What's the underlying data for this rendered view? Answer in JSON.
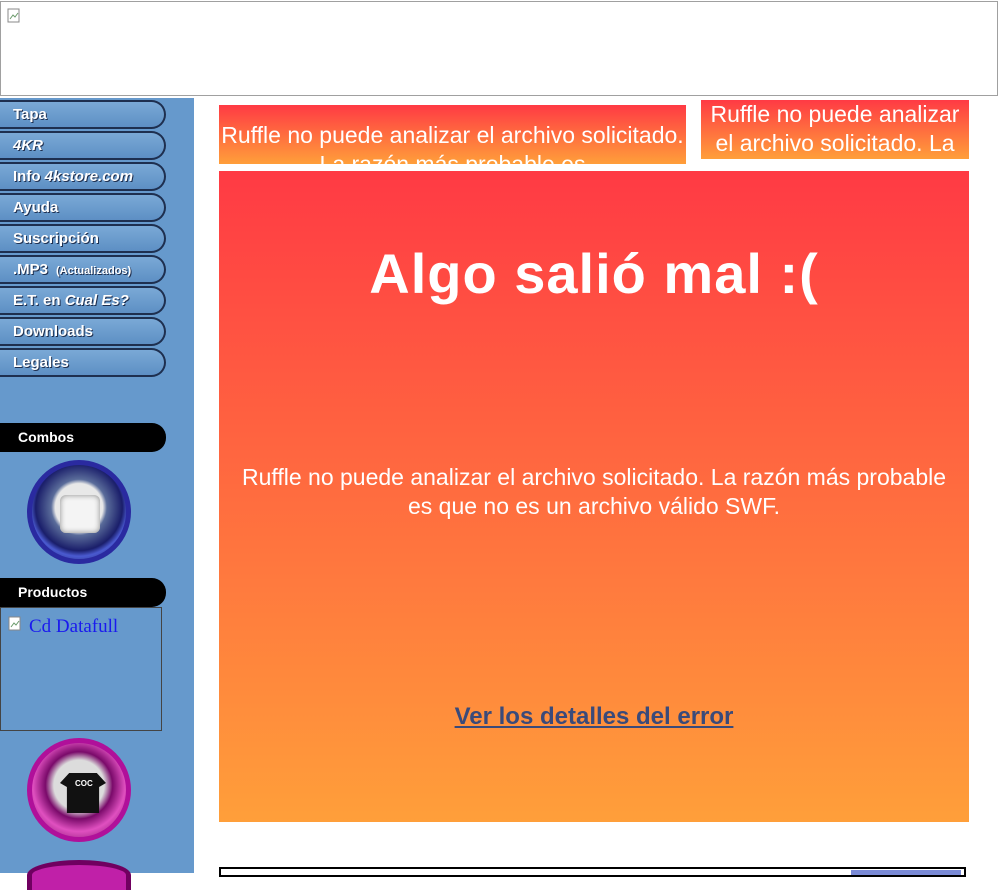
{
  "nav": {
    "items": [
      {
        "label": "Tapa"
      },
      {
        "label": "4KR"
      },
      {
        "label": "Info",
        "extra": "4kstore.com"
      },
      {
        "label": "Ayuda"
      },
      {
        "label": "Suscripción"
      },
      {
        "label": ".MP3",
        "extra": "(Actualizados)"
      },
      {
        "label": "E.T. en",
        "extra": "Cual Es?"
      },
      {
        "label": "Downloads"
      },
      {
        "label": "Legales"
      }
    ]
  },
  "sections": {
    "combos": "Combos",
    "productos": "Productos",
    "product_link": "Cd Datafull",
    "shirt_logo": "COC"
  },
  "ruffle": {
    "small_1": "Ruffle no puede analizar el archivo solicitado. La razón más probable es",
    "small_2": "Ruffle no puede analizar el archivo solicitado. La razón",
    "title": "Algo salió mal :(",
    "message": "Ruffle no puede analizar el archivo solicitado. La razón más probable es que no es un archivo válido SWF.",
    "details_link": "Ver los detalles del error"
  },
  "colors": {
    "sidebar": "#6699cc",
    "ruffle_top": "#ff3a44",
    "ruffle_bottom": "#ff9f3a"
  }
}
